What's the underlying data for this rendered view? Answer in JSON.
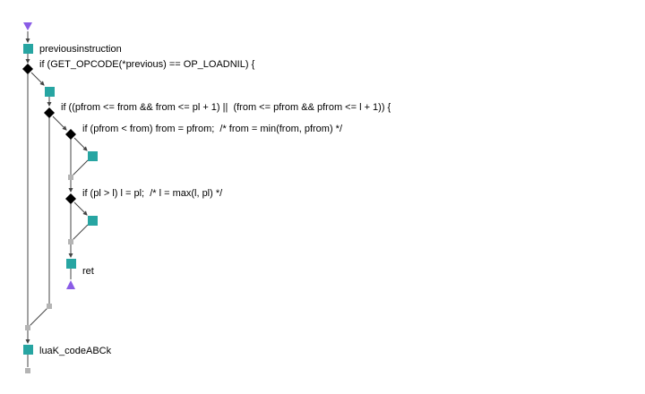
{
  "nodes": {
    "previous_instruction": "previousinstruction",
    "if_loadnil": "if (GET_OPCODE(*previous) == OP_LOADNIL) {",
    "if_overlap": "if ((pfrom <= from && from <= pl + 1) ||  (from <= pfrom && pfrom <= l + 1)) {",
    "if_min": "if (pfrom < from) from = pfrom;  /* from = min(from, pfrom) */",
    "if_max": "if (pl > l) l = pl;  /* l = max(l, pl) */",
    "ret": "ret",
    "codeabck": "luaK_codeABCk"
  },
  "colors": {
    "statement": "#27a5a2",
    "decision": "#000000",
    "merge": "#b4b4b4",
    "terminal": "#8a5ce6"
  }
}
